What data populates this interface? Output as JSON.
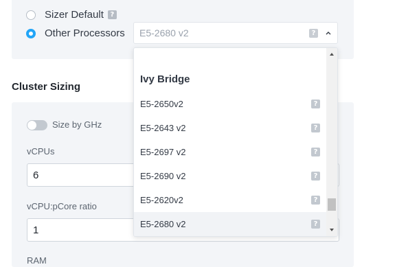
{
  "processor_choice": {
    "sizer_default_label": "Sizer Default",
    "other_processors_label": "Other Processors",
    "help_glyph": "?",
    "selected_value": "E5-2680 v2"
  },
  "cluster_sizing": {
    "title": "Cluster Sizing",
    "size_by_ghz_label": "Size by GHz",
    "vcpus_label": "vCPUs",
    "vcpus_value": "6",
    "ratio_label": "vCPU:pCore ratio",
    "ratio_value": "1",
    "ram_label": "RAM"
  },
  "dropdown": {
    "group": "Ivy Bridge",
    "options": [
      {
        "label": "E5-2650v2"
      },
      {
        "label": "E5-2643 v2"
      },
      {
        "label": "E5-2697 v2"
      },
      {
        "label": "E5-2690 v2"
      },
      {
        "label": "E5-2620v2"
      },
      {
        "label": "E5-2680 v2"
      }
    ]
  },
  "colors": {
    "accent": "#22a5f7",
    "panel_bg": "#f3f5f8",
    "help_badge": "#b6bcc4"
  },
  "icons": {
    "radio_checked": "radio-checked-icon",
    "radio_unchecked": "radio-unchecked-icon",
    "help": "question-mark-icon",
    "chevron_up": "chevron-up-icon"
  }
}
